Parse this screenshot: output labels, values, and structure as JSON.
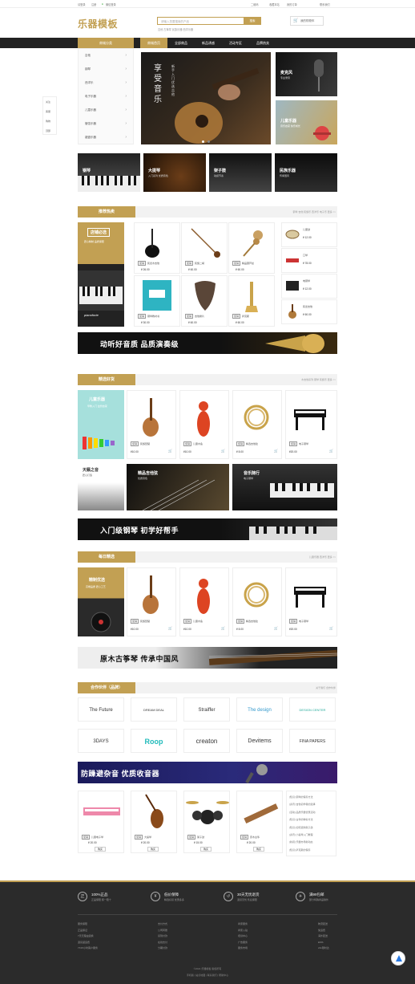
{
  "topbar": {
    "left": [
      "请登录",
      "注册",
      "微信登录"
    ],
    "right": [
      "二维码",
      "收藏本站",
      "我的订单",
      "联系我们"
    ]
  },
  "header": {
    "logo": "乐器模板",
    "search_placeholder": "请输入您要搜索的产品",
    "search_button": "搜索",
    "hot_words": "吉他  古筝琴  民族乐器  西洋乐器",
    "cart_label": "我的购物车"
  },
  "nav": {
    "category_button": "商城分类",
    "items": [
      "商城首页",
      "全部商品",
      "新品诱惑",
      "活动专区",
      "品牌热卖"
    ],
    "active": 0
  },
  "categories": [
    "吉他",
    "钢琴",
    "西洋乐",
    "电子乐器",
    "儿童乐器",
    "管弦乐器",
    "键盘乐器"
  ],
  "side_float": [
    "关注",
    "客服",
    "购物",
    "顶部"
  ],
  "banner": {
    "title": "享受音乐",
    "subtitle": "新手入门 优选吉他"
  },
  "side_cards": [
    {
      "title": "麦克风",
      "sub": "专业录音"
    },
    {
      "title": "儿童乐器",
      "sub": "音乐启蒙 快乐成长"
    }
  ],
  "cat_cards": [
    {
      "title": "钢琴",
      "sub": "演奏级音色"
    },
    {
      "title": "大提琴",
      "sub": "入门系列 优质音色"
    },
    {
      "title": "架子鼓",
      "sub": "动感节奏"
    },
    {
      "title": "民族乐器",
      "sub": "传承国风"
    }
  ],
  "section_hot": {
    "title": "推荐热卖",
    "links": "钢琴  吉他  民族乐  西洋乐  电子乐  更多 >>",
    "promo_title": "店铺必选",
    "promo_sub": "匠心精制 品质保障",
    "promo_img_text": "pianoforte",
    "products": [
      {
        "tag": "促销",
        "name": "民谣木吉他",
        "price": "¥ 26.00"
      },
      {
        "tag": "促销",
        "name": "民族二胡",
        "price": "¥ 60.00"
      },
      {
        "tag": "促销",
        "name": "精品葫芦丝",
        "price": "¥ 60.00"
      },
      {
        "tag": "促销",
        "name": "钢琴教材书",
        "price": "¥ 30.00"
      },
      {
        "tag": "促销",
        "name": "吉他拨片",
        "price": "¥ 60.00"
      },
      {
        "tag": "促销",
        "name": "萨克斯",
        "price": "¥ 60.00"
      }
    ],
    "mini": [
      {
        "name": "儿童鼓",
        "price": "¥ 12.00"
      },
      {
        "name": "口琴",
        "price": "¥ 78.00"
      },
      {
        "name": "电钢琴",
        "price": "¥ 12.00"
      },
      {
        "name": "民谣吉他",
        "price": "¥ 60.00"
      }
    ]
  },
  "strip1": "动听好音质 品质演奏级",
  "section_good": {
    "title": "精选好货",
    "links": "木吉他系列  钢琴  民族乐  更多 >>",
    "promo_title": "儿童乐器",
    "promo_sub": "早教入门 益智启蒙",
    "products": [
      {
        "tag": "促销",
        "name": "民族琵琶",
        "price": "¥10.00"
      },
      {
        "tag": "促销",
        "name": "儿童木鱼",
        "price": "¥10.00"
      },
      {
        "tag": "促销",
        "name": "精选吉他弦",
        "price": "¥ 8.00"
      },
      {
        "tag": "促销",
        "name": "电子钢琴",
        "price": "¥20.00"
      }
    ],
    "cards": [
      {
        "title": "天籁之音",
        "sub": "匠心打造"
      },
      {
        "title": "精品吉他弦",
        "sub": "优质音色"
      },
      {
        "title": "音乐随行",
        "sub": "电子钢琴"
      }
    ]
  },
  "strip2": "入门级钢琴 初学好帮手",
  "section_daily": {
    "title": "每日精选",
    "links": "儿童乐器  西洋乐  更多 >>",
    "promo_title": "精制优选",
    "promo_sub": "高端品质 匠心工艺",
    "products": [
      {
        "tag": "促销",
        "name": "民族琵琶",
        "price": "¥10.00"
      },
      {
        "tag": "促销",
        "name": "儿童木鱼",
        "price": "¥10.00"
      },
      {
        "tag": "促销",
        "name": "精选吉他弦",
        "price": "¥ 8.00"
      },
      {
        "tag": "促销",
        "name": "电子钢琴",
        "price": "¥20.00"
      }
    ]
  },
  "strip3": "原木古筝琴 传承中国风",
  "section_partner": {
    "title": "合作伙伴（品牌）",
    "links": "关于我们  合作伙伴",
    "brands": [
      "The Future",
      "DREAM DEAL",
      "Straiffer",
      "The design",
      "DESIGN CENTER",
      "3DAYS",
      "Roop",
      "creaton",
      "Devitems",
      "FINA PAPERS"
    ]
  },
  "strip4": "防躁避杂音 优质收音器",
  "special": [
    {
      "tag": "促销",
      "name": "儿童电子琴",
      "price": "¥ 20.00",
      "buy": "购买"
    },
    {
      "tag": "促销",
      "name": "大提琴",
      "price": "¥ 20.00",
      "buy": "购买"
    },
    {
      "tag": "促销",
      "name": "架子鼓",
      "price": "¥ 15.00",
      "buy": "购买"
    },
    {
      "tag": "促销",
      "name": "原木古筝",
      "price": "¥ 20.00",
      "buy": "购买"
    }
  ],
  "news": [
    "[知识] 钢琴的保养方法",
    "[资讯] 吉他初学者的选择",
    "[活动] 品质乐器优惠活动",
    "[知识] 古筝的弹奏方法",
    "[知识] 如何选购架子鼓",
    "[资讯] 小提琴入门教程",
    "[新闻] 乐器市场新动态",
    "[知识] 萨克斯的保养"
  ],
  "footer": {
    "guarantees": [
      {
        "title": "100%正品",
        "sub": "正品保障 假一赔十"
      },
      {
        "title": "低价保障",
        "sub": "精选好货 优惠多多"
      },
      {
        "title": "30天无忧退货",
        "sub": "退货无忧 售后保障"
      },
      {
        "title": "满99包邮",
        "sub": "部分特殊商品除外"
      }
    ],
    "cols": [
      [
        "服务保障",
        "正品保证",
        "7天无理由退换",
        "退货返运费",
        "7X15小时客户服务"
      ],
      [
        "支付方式",
        "公司转账",
        "货到付款",
        "在线支付",
        "分期付款"
      ],
      [
        "商家服务",
        "商家入驻",
        "培训中心",
        "广告服务",
        "服务市场"
      ],
      [
        "物流配送",
        "免运费",
        "海外配送",
        "EMS",
        "211限时达"
      ]
    ],
    "copyright": "©2021 乐器模板 版权所有",
    "links": "手机版 | 站点地图 | 联系我们 | 帮助中心"
  }
}
